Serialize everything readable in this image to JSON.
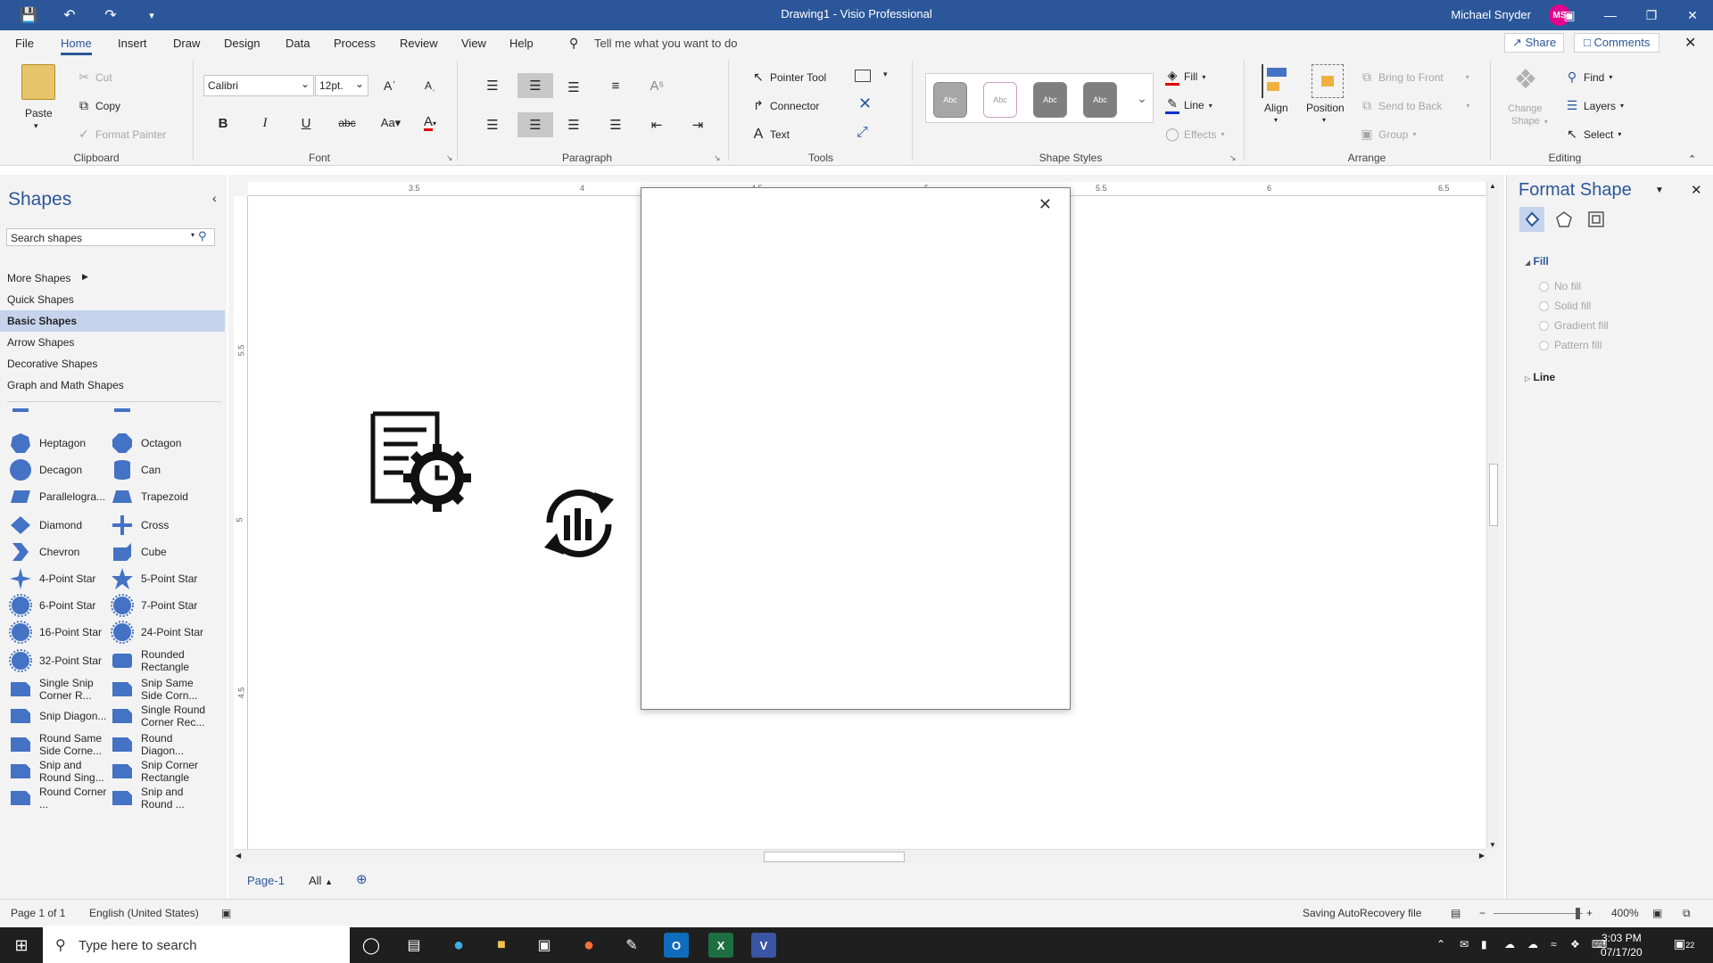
{
  "titlebar": {
    "title": "Drawing1  -  Visio Professional",
    "user_name": "Michael Snyder",
    "user_initials": "MS"
  },
  "menu": {
    "tabs": [
      "File",
      "Home",
      "Insert",
      "Draw",
      "Design",
      "Data",
      "Process",
      "Review",
      "View",
      "Help"
    ],
    "active_tab": "Home",
    "tell_me": "Tell me what you want to do",
    "share": "Share",
    "comments": "Comments"
  },
  "ribbon": {
    "clipboard": {
      "label": "Clipboard",
      "paste": "Paste",
      "cut": "Cut",
      "copy": "Copy",
      "format_painter": "Format Painter"
    },
    "font": {
      "label": "Font",
      "font_name": "Calibri",
      "font_size": "12pt."
    },
    "paragraph": {
      "label": "Paragraph"
    },
    "tools": {
      "label": "Tools",
      "pointer": "Pointer Tool",
      "connector": "Connector",
      "text": "Text"
    },
    "shape_styles": {
      "label": "Shape Styles",
      "swatch_text": "Abc"
    },
    "fill_line": {
      "fill": "Fill",
      "line": "Line",
      "effects": "Effects"
    },
    "arrange": {
      "label": "Arrange",
      "align": "Align",
      "position": "Position",
      "bring_front": "Bring to Front",
      "send_back": "Send to Back",
      "group": "Group"
    },
    "editing": {
      "label": "Editing",
      "change_shape_1": "Change",
      "change_shape_2": "Shape",
      "find": "Find",
      "layers": "Layers",
      "select": "Select"
    }
  },
  "shapes_pane": {
    "title": "Shapes",
    "search_placeholder": "Search shapes",
    "stencils": [
      "More Shapes",
      "Quick Shapes",
      "Basic Shapes",
      "Arrow Shapes",
      "Decorative Shapes",
      "Graph and Math Shapes"
    ],
    "active_stencil": "Basic Shapes",
    "items": [
      [
        "Heptagon",
        "Octagon"
      ],
      [
        "Decagon",
        "Can"
      ],
      [
        "Parallelogra...",
        "Trapezoid"
      ],
      [
        "Diamond",
        "Cross"
      ],
      [
        "Chevron",
        "Cube"
      ],
      [
        "4-Point Star",
        "5-Point Star"
      ],
      [
        "6-Point Star",
        "7-Point Star"
      ],
      [
        "16-Point Star",
        "24-Point Star"
      ],
      [
        "32-Point Star",
        "Rounded Rectangle"
      ],
      [
        "Single Snip Corner R...",
        "Snip Same Side Corn..."
      ],
      [
        "Snip Diagon...",
        "Single Round Corner Rec..."
      ],
      [
        "Round Same Side Corne...",
        "Round Diagon..."
      ],
      [
        "Snip and Round Sing...",
        "Snip Corner Rectangle"
      ],
      [
        "Round Corner ...",
        "Snip and Round ..."
      ]
    ]
  },
  "rulers": {
    "top": [
      "3.5",
      "4",
      "4.5",
      "5",
      "5.5",
      "6",
      "6.5"
    ],
    "left": [
      "5.5",
      "5",
      "4.5"
    ]
  },
  "page_tabs": {
    "page": "Page-1",
    "all": "All"
  },
  "format_pane": {
    "title": "Format Shape",
    "fill_section": "Fill",
    "fill_options": [
      "No fill",
      "Solid fill",
      "Gradient fill",
      "Pattern fill"
    ],
    "line_section": "Line"
  },
  "status": {
    "page": "Page 1 of 1",
    "language": "English (United States)",
    "saving": "Saving AutoRecovery file",
    "zoom": "400%"
  },
  "taskbar": {
    "search": "Type here to search",
    "time": "3:03 PM",
    "date": "07/17/20",
    "notifications": "22"
  },
  "colors": {
    "accent": "#2b579a",
    "shape_blue": "#4472c4"
  }
}
